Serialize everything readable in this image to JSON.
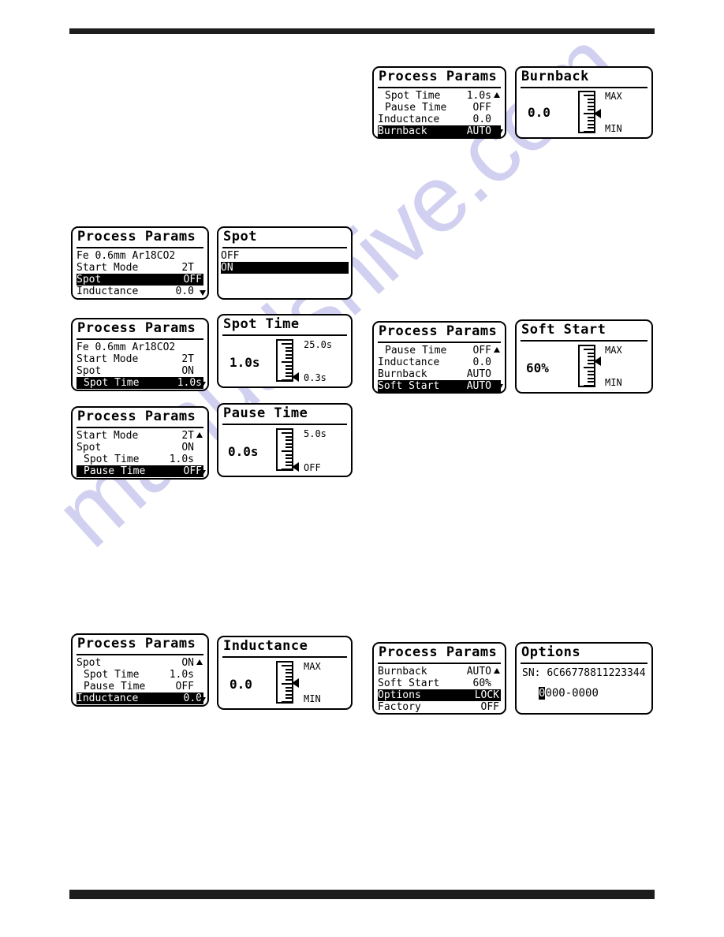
{
  "page": {
    "watermark": "manualshive.com",
    "top_rule": true,
    "bottom_rule": true
  },
  "screens": {
    "burnback_menu": {
      "title": "Process Params",
      "rows": [
        {
          "label": "Spot Time",
          "value": "1.0s",
          "indent": true,
          "selected": false,
          "arrow": "up"
        },
        {
          "label": "Pause Time",
          "value": "OFF",
          "indent": true,
          "selected": false,
          "arrow": ""
        },
        {
          "label": "Inductance",
          "value": "0.0",
          "indent": false,
          "selected": false,
          "arrow": ""
        },
        {
          "label": "Burnback",
          "value": "AUTO",
          "indent": false,
          "selected": true,
          "arrow": "down"
        }
      ]
    },
    "burnback_detail": {
      "title": "Burnback",
      "value": "0.0",
      "top_label": "MAX",
      "bottom_label": "MIN",
      "pointer_pct": 55
    },
    "spot_menu": {
      "title": "Process Params",
      "rows": [
        {
          "label": "Fe 0.6mm Ar18CO2",
          "value": "",
          "indent": false,
          "selected": false,
          "arrow": ""
        },
        {
          "label": "Start Mode",
          "value": "2T",
          "indent": false,
          "selected": false,
          "arrow": ""
        },
        {
          "label": "Spot",
          "value": "OFF",
          "indent": false,
          "selected": true,
          "arrow": ""
        },
        {
          "label": "Inductance",
          "value": "0.0",
          "indent": false,
          "selected": false,
          "arrow": "down"
        }
      ]
    },
    "spot_list": {
      "title": "Spot",
      "options": [
        {
          "label": "OFF",
          "selected": false
        },
        {
          "label": "ON",
          "selected": true
        }
      ]
    },
    "spot_time_menu": {
      "title": "Process Params",
      "rows": [
        {
          "label": "Fe 0.6mm Ar18CO2",
          "value": "",
          "indent": false,
          "selected": false,
          "arrow": ""
        },
        {
          "label": "Start Mode",
          "value": "2T",
          "indent": false,
          "selected": false,
          "arrow": ""
        },
        {
          "label": "Spot",
          "value": "ON",
          "indent": false,
          "selected": false,
          "arrow": ""
        },
        {
          "label": "Spot Time",
          "value": "1.0s",
          "indent": true,
          "selected": true,
          "arrow": "down"
        }
      ]
    },
    "spot_time_detail": {
      "title": "Spot Time",
      "value": "1.0s",
      "top_label": "25.0s",
      "bottom_label": "0.3s",
      "pointer_pct": 92
    },
    "pause_time_menu": {
      "title": "Process Params",
      "rows": [
        {
          "label": "Start Mode",
          "value": "2T",
          "indent": false,
          "selected": false,
          "arrow": "up"
        },
        {
          "label": "Spot",
          "value": "ON",
          "indent": false,
          "selected": false,
          "arrow": ""
        },
        {
          "label": "Spot Time",
          "value": "1.0s",
          "indent": true,
          "selected": false,
          "arrow": ""
        },
        {
          "label": "Pause Time",
          "value": "OFF",
          "indent": true,
          "selected": true,
          "arrow": "down"
        }
      ]
    },
    "pause_time_detail": {
      "title": "Pause Time",
      "value": "0.0s",
      "top_label": "5.0s",
      "bottom_label": "OFF",
      "pointer_pct": 95
    },
    "soft_start_menu": {
      "title": "Process Params",
      "rows": [
        {
          "label": "Pause Time",
          "value": "OFF",
          "indent": true,
          "selected": false,
          "arrow": "up"
        },
        {
          "label": "Inductance",
          "value": "0.0",
          "indent": false,
          "selected": false,
          "arrow": ""
        },
        {
          "label": "Burnback",
          "value": "AUTO",
          "indent": false,
          "selected": false,
          "arrow": ""
        },
        {
          "label": "Soft Start",
          "value": "AUTO",
          "indent": false,
          "selected": true,
          "arrow": "down"
        }
      ]
    },
    "soft_start_detail": {
      "title": "Soft Start",
      "value": "60%",
      "top_label": "MAX",
      "bottom_label": "MIN",
      "pointer_pct": 38
    },
    "inductance_menu": {
      "title": "Process Params",
      "rows": [
        {
          "label": "Spot",
          "value": "ON",
          "indent": false,
          "selected": false,
          "arrow": "up"
        },
        {
          "label": "Spot Time",
          "value": "1.0s",
          "indent": true,
          "selected": false,
          "arrow": ""
        },
        {
          "label": "Pause Time",
          "value": "OFF",
          "indent": true,
          "selected": false,
          "arrow": ""
        },
        {
          "label": "Inductance",
          "value": "0.0",
          "indent": false,
          "selected": true,
          "arrow": "down"
        }
      ]
    },
    "inductance_detail": {
      "title": "Inductance",
      "value": "0.0",
      "top_label": "MAX",
      "bottom_label": "MIN",
      "pointer_pct": 52
    },
    "options_menu": {
      "title": "Process Params",
      "rows": [
        {
          "label": "Burnback",
          "value": "AUTO",
          "indent": false,
          "selected": false,
          "arrow": "up"
        },
        {
          "label": "Soft Start",
          "value": "60%",
          "indent": false,
          "selected": false,
          "arrow": ""
        },
        {
          "label": "Options",
          "value": "LOCK",
          "indent": false,
          "selected": true,
          "arrow": ""
        },
        {
          "label": "Factory",
          "value": "OFF",
          "indent": false,
          "selected": false,
          "arrow": ""
        }
      ]
    },
    "options_detail": {
      "title": "Options",
      "sn_label": "SN:",
      "sn_value": "6C66778811223344",
      "code_cursor": "0",
      "code_rest": "000-0000"
    }
  }
}
